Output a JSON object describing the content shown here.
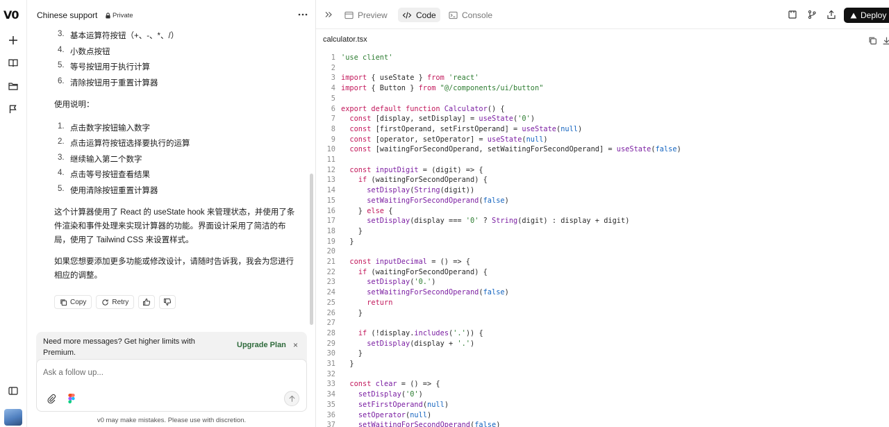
{
  "rail": {
    "logo": "V0",
    "items": [
      {
        "name": "plus-icon"
      },
      {
        "name": "book-icon"
      },
      {
        "name": "folder-icon"
      },
      {
        "name": "flag-icon"
      },
      {
        "name": "sidebar-toggle-icon"
      }
    ]
  },
  "chat": {
    "title": "Chinese support",
    "privacy": "Private",
    "list_a": [
      {
        "num": "3.",
        "text": "基本运算符按钮（+、-、*、/）"
      },
      {
        "num": "4.",
        "text": "小数点按钮"
      },
      {
        "num": "5.",
        "text": "等号按钮用于执行计算"
      },
      {
        "num": "6.",
        "text": "清除按钮用于重置计算器"
      }
    ],
    "usage_heading": "使用说明：",
    "list_b": [
      {
        "num": "1.",
        "text": "点击数字按钮输入数字"
      },
      {
        "num": "2.",
        "text": "点击运算符按钮选择要执行的运算"
      },
      {
        "num": "3.",
        "text": "继续输入第二个数字"
      },
      {
        "num": "4.",
        "text": "点击等号按钮查看结果"
      },
      {
        "num": "5.",
        "text": "使用清除按钮重置计算器"
      }
    ],
    "para1": "这个计算器使用了 React 的 useState hook 来管理状态，并使用了条件渲染和事件处理来实现计算器的功能。界面设计采用了简洁的布局，使用了 Tailwind CSS 来设置样式。",
    "para2": "如果您想要添加更多功能或修改设计，请随时告诉我，我会为您进行相应的调整。",
    "actions": {
      "copy": "Copy",
      "retry": "Retry"
    },
    "upsell": {
      "text": "Need more messages? Get higher limits with Premium.",
      "cta": "Upgrade Plan",
      "close": "×"
    },
    "composer": {
      "placeholder": "Ask a follow up..."
    },
    "disclaimer": "v0 may make mistakes. Please use with discretion."
  },
  "code_panel": {
    "tabs": {
      "preview": "Preview",
      "code": "Code",
      "console": "Console"
    },
    "deploy": "Deploy",
    "filename": "calculator.tsx",
    "lines": [
      [
        [
          "s",
          "'use client'"
        ]
      ],
      [],
      [
        [
          "k",
          "import"
        ],
        [
          "p",
          " { useState } "
        ],
        [
          "k",
          "from"
        ],
        [
          "s",
          " 'react'"
        ]
      ],
      [
        [
          "k",
          "import"
        ],
        [
          "p",
          " { Button } "
        ],
        [
          "k",
          "from"
        ],
        [
          "s",
          " \"@/components/ui/button\""
        ]
      ],
      [],
      [
        [
          "k",
          "export default function"
        ],
        [
          "f",
          " Calculator"
        ],
        [
          "p",
          "() {"
        ]
      ],
      [
        [
          "p",
          "  "
        ],
        [
          "k",
          "const"
        ],
        [
          "p",
          " [display, setDisplay] = "
        ],
        [
          "f",
          "useState"
        ],
        [
          "p",
          "("
        ],
        [
          "s",
          "'0'"
        ],
        [
          "p",
          ")"
        ]
      ],
      [
        [
          "p",
          "  "
        ],
        [
          "k",
          "const"
        ],
        [
          "p",
          " [firstOperand, setFirstOperand] = "
        ],
        [
          "f",
          "useState"
        ],
        [
          "p",
          "("
        ],
        [
          "b",
          "null"
        ],
        [
          "p",
          ")"
        ]
      ],
      [
        [
          "p",
          "  "
        ],
        [
          "k",
          "const"
        ],
        [
          "p",
          " [operator, setOperator] = "
        ],
        [
          "f",
          "useState"
        ],
        [
          "p",
          "("
        ],
        [
          "b",
          "null"
        ],
        [
          "p",
          ")"
        ]
      ],
      [
        [
          "p",
          "  "
        ],
        [
          "k",
          "const"
        ],
        [
          "p",
          " [waitingForSecondOperand, setWaitingForSecondOperand] = "
        ],
        [
          "f",
          "useState"
        ],
        [
          "p",
          "("
        ],
        [
          "b",
          "false"
        ],
        [
          "p",
          ")"
        ]
      ],
      [],
      [
        [
          "p",
          "  "
        ],
        [
          "k",
          "const"
        ],
        [
          "f",
          " inputDigit"
        ],
        [
          "p",
          " = (digit) => {"
        ]
      ],
      [
        [
          "p",
          "    "
        ],
        [
          "k",
          "if"
        ],
        [
          "p",
          " (waitingForSecondOperand) {"
        ]
      ],
      [
        [
          "p",
          "      "
        ],
        [
          "f",
          "setDisplay"
        ],
        [
          "p",
          "("
        ],
        [
          "f",
          "String"
        ],
        [
          "p",
          "(digit))"
        ]
      ],
      [
        [
          "p",
          "      "
        ],
        [
          "f",
          "setWaitingForSecondOperand"
        ],
        [
          "p",
          "("
        ],
        [
          "b",
          "false"
        ],
        [
          "p",
          ")"
        ]
      ],
      [
        [
          "p",
          "    } "
        ],
        [
          "k",
          "else"
        ],
        [
          "p",
          " {"
        ]
      ],
      [
        [
          "p",
          "      "
        ],
        [
          "f",
          "setDisplay"
        ],
        [
          "p",
          "(display === "
        ],
        [
          "s",
          "'0'"
        ],
        [
          "p",
          " ? "
        ],
        [
          "f",
          "String"
        ],
        [
          "p",
          "(digit) : display + digit)"
        ]
      ],
      [
        [
          "p",
          "    }"
        ]
      ],
      [
        [
          "p",
          "  }"
        ]
      ],
      [],
      [
        [
          "p",
          "  "
        ],
        [
          "k",
          "const"
        ],
        [
          "f",
          " inputDecimal"
        ],
        [
          "p",
          " = () => {"
        ]
      ],
      [
        [
          "p",
          "    "
        ],
        [
          "k",
          "if"
        ],
        [
          "p",
          " (waitingForSecondOperand) {"
        ]
      ],
      [
        [
          "p",
          "      "
        ],
        [
          "f",
          "setDisplay"
        ],
        [
          "p",
          "("
        ],
        [
          "s",
          "'0.'"
        ],
        [
          "p",
          ")"
        ]
      ],
      [
        [
          "p",
          "      "
        ],
        [
          "f",
          "setWaitingForSecondOperand"
        ],
        [
          "p",
          "("
        ],
        [
          "b",
          "false"
        ],
        [
          "p",
          ")"
        ]
      ],
      [
        [
          "p",
          "      "
        ],
        [
          "k",
          "return"
        ]
      ],
      [
        [
          "p",
          "    }"
        ]
      ],
      [],
      [
        [
          "p",
          "    "
        ],
        [
          "k",
          "if"
        ],
        [
          "p",
          " (!display."
        ],
        [
          "f",
          "includes"
        ],
        [
          "p",
          "("
        ],
        [
          "s",
          "'.'"
        ],
        [
          "p",
          ")) {"
        ]
      ],
      [
        [
          "p",
          "      "
        ],
        [
          "f",
          "setDisplay"
        ],
        [
          "p",
          "(display + "
        ],
        [
          "s",
          "'.'"
        ],
        [
          "p",
          ")"
        ]
      ],
      [
        [
          "p",
          "    }"
        ]
      ],
      [
        [
          "p",
          "  }"
        ]
      ],
      [],
      [
        [
          "p",
          "  "
        ],
        [
          "k",
          "const"
        ],
        [
          "f",
          " clear"
        ],
        [
          "p",
          " = () => {"
        ]
      ],
      [
        [
          "p",
          "    "
        ],
        [
          "f",
          "setDisplay"
        ],
        [
          "p",
          "("
        ],
        [
          "s",
          "'0'"
        ],
        [
          "p",
          ")"
        ]
      ],
      [
        [
          "p",
          "    "
        ],
        [
          "f",
          "setFirstOperand"
        ],
        [
          "p",
          "("
        ],
        [
          "b",
          "null"
        ],
        [
          "p",
          ")"
        ]
      ],
      [
        [
          "p",
          "    "
        ],
        [
          "f",
          "setOperator"
        ],
        [
          "p",
          "("
        ],
        [
          "b",
          "null"
        ],
        [
          "p",
          ")"
        ]
      ],
      [
        [
          "p",
          "    "
        ],
        [
          "f",
          "setWaitingForSecondOperand"
        ],
        [
          "p",
          "("
        ],
        [
          "b",
          "false"
        ],
        [
          "p",
          ")"
        ]
      ]
    ]
  },
  "colors": {
    "keyword": "#c2185b",
    "string": "#2e7d32",
    "function": "#7b1fa2",
    "literal": "#1565c0",
    "upgrade": "#2f6b3c",
    "deploy_bg": "#111111"
  }
}
